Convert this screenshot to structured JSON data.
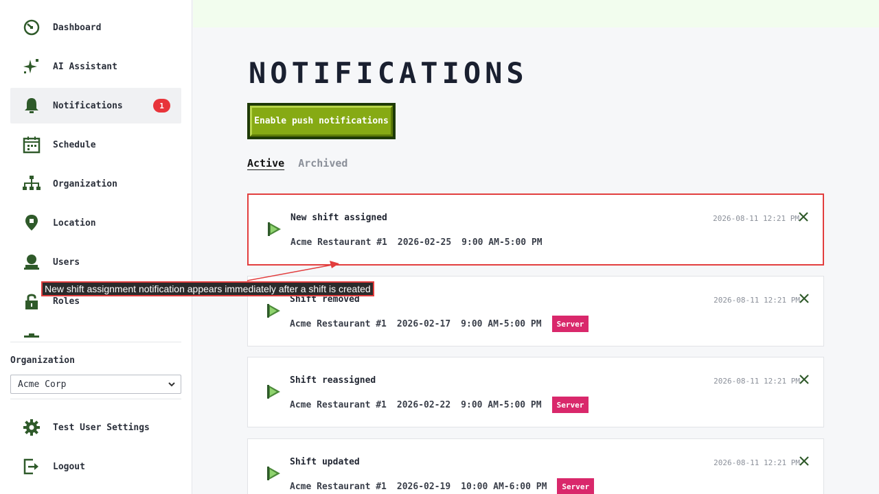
{
  "sidebar": {
    "items": [
      {
        "label": "Dashboard",
        "icon": "dashboard-icon"
      },
      {
        "label": "AI Assistant",
        "icon": "sparkle-icon"
      },
      {
        "label": "Notifications",
        "icon": "bell-icon",
        "badge": "1",
        "active": true
      },
      {
        "label": "Schedule",
        "icon": "calendar-icon"
      },
      {
        "label": "Organization",
        "icon": "org-chart-icon"
      },
      {
        "label": "Location",
        "icon": "location-pin-icon"
      },
      {
        "label": "Users",
        "icon": "user-icon"
      },
      {
        "label": "Roles",
        "icon": "lock-icon"
      }
    ],
    "org_label": "Organization",
    "org_selected": "Acme Corp",
    "settings_label": "Test User Settings",
    "logout_label": "Logout"
  },
  "main": {
    "title": "NOTIFICATIONS",
    "push_button": "Enable push notifications",
    "tabs": [
      {
        "label": "Active",
        "active": true
      },
      {
        "label": "Archived",
        "active": false
      }
    ],
    "notifications": [
      {
        "title": "New shift assigned",
        "location": "Acme Restaurant #1",
        "date": "2026-02-25",
        "time": "9:00 AM-5:00 PM",
        "role": "",
        "timestamp": "2026-08-11 12:21 PM"
      },
      {
        "title": "Shift removed",
        "location": "Acme Restaurant #1",
        "date": "2026-02-17",
        "time": "9:00 AM-5:00 PM",
        "role": "Server",
        "timestamp": "2026-08-11 12:21 PM"
      },
      {
        "title": "Shift reassigned",
        "location": "Acme Restaurant #1",
        "date": "2026-02-22",
        "time": "9:00 AM-5:00 PM",
        "role": "Server",
        "timestamp": "2026-08-11 12:21 PM"
      },
      {
        "title": "Shift updated",
        "location": "Acme Restaurant #1",
        "date": "2026-02-19",
        "time": "10:00 AM-6:00 PM",
        "role": "Server",
        "timestamp": "2026-08-11 12:21 PM"
      }
    ]
  },
  "annotation": {
    "text": "New shift assignment notification appears immediately after a shift is created"
  },
  "colors": {
    "accent_green": "#86aa14",
    "dark_green": "#1e3a06",
    "badge_red": "#e8343a",
    "role_pink": "#d9286b",
    "highlight_red": "#e23d3d"
  }
}
